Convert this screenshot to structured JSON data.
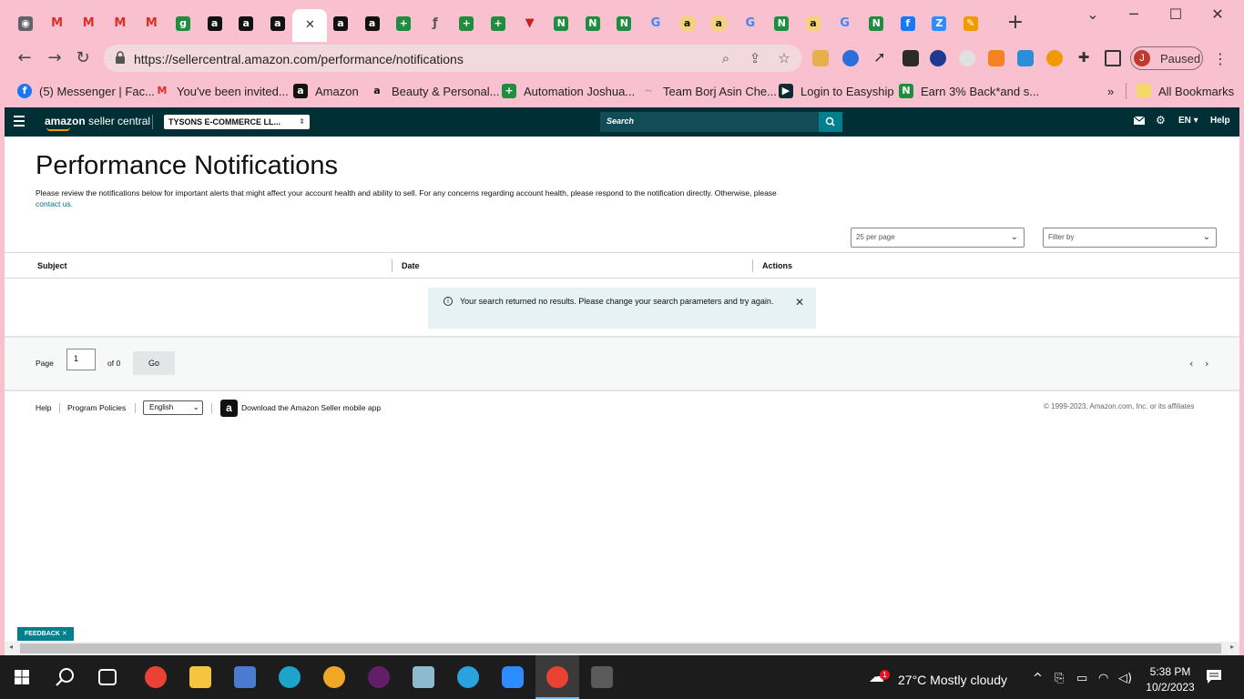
{
  "browser": {
    "url": "https://sellercentral.amazon.com/performance/notifications",
    "profile_initial": "J",
    "profile_status": "Paused",
    "tabs": [
      {
        "icon": "chrome-icon",
        "color": "#5f6368",
        "glyph": "◉"
      },
      {
        "icon": "gmail-icon",
        "color": "#d93025",
        "glyph": "M"
      },
      {
        "icon": "gmail-icon",
        "color": "#d93025",
        "glyph": "M"
      },
      {
        "icon": "gmail-icon",
        "color": "#d93025",
        "glyph": "M"
      },
      {
        "icon": "gmail-icon",
        "color": "#d93025",
        "glyph": "M"
      },
      {
        "icon": "green-circle-icon",
        "color": "#1e8e3e",
        "glyph": "g"
      },
      {
        "icon": "amazon-icon",
        "color": "#111111",
        "glyph": "a"
      },
      {
        "icon": "amazon-icon",
        "color": "#111111",
        "glyph": "a"
      },
      {
        "icon": "amazon-icon",
        "color": "#111111",
        "glyph": "a"
      },
      {
        "icon": "close-icon",
        "color": "#333333",
        "glyph": "✕"
      },
      {
        "icon": "amazon-icon",
        "color": "#111111",
        "glyph": "a"
      },
      {
        "icon": "amazon-icon",
        "color": "#111111",
        "glyph": "a"
      },
      {
        "icon": "sheets-plus-icon",
        "color": "#1e8e3e",
        "glyph": "+"
      },
      {
        "icon": "script-icon",
        "color": "#555555",
        "glyph": "ƒ"
      },
      {
        "icon": "sheets-plus-icon",
        "color": "#1e8e3e",
        "glyph": "+"
      },
      {
        "icon": "sheets-plus-icon",
        "color": "#1e8e3e",
        "glyph": "+"
      },
      {
        "icon": "red-down-icon",
        "color": "#c5221f",
        "glyph": "▼"
      },
      {
        "icon": "green-n-icon",
        "color": "#1e8e3e",
        "glyph": "N"
      },
      {
        "icon": "green-n-icon",
        "color": "#1e8e3e",
        "glyph": "N"
      },
      {
        "icon": "green-n-icon",
        "color": "#1e8e3e",
        "glyph": "N"
      },
      {
        "icon": "google-icon",
        "color": "#4285f4",
        "glyph": "G"
      },
      {
        "icon": "amazon-icon",
        "color": "#ffffff",
        "glyph": "a"
      },
      {
        "icon": "amazon-icon",
        "color": "#ffffff",
        "glyph": "a"
      },
      {
        "icon": "google-icon",
        "color": "#4285f4",
        "glyph": "G"
      },
      {
        "icon": "green-n-icon",
        "color": "#1e8e3e",
        "glyph": "N"
      },
      {
        "icon": "amazon-icon",
        "color": "#ffffff",
        "glyph": "a"
      },
      {
        "icon": "google-icon",
        "color": "#4285f4",
        "glyph": "G"
      },
      {
        "icon": "green-n-icon",
        "color": "#1e8e3e",
        "glyph": "N"
      },
      {
        "icon": "facebook-icon",
        "color": "#1877f2",
        "glyph": "f"
      },
      {
        "icon": "zoom-icon",
        "color": "#2d8cff",
        "glyph": "Z"
      },
      {
        "icon": "pencil-icon",
        "color": "#f29900",
        "glyph": "✎"
      }
    ],
    "bookmarks": [
      {
        "label": "(5) Messenger | Fac...",
        "icon": "facebook-icon",
        "color": "#1877f2",
        "glyph": "f"
      },
      {
        "label": "You've been invited...",
        "icon": "gmail-icon",
        "color": "#d93025",
        "glyph": "M"
      },
      {
        "label": "Amazon",
        "icon": "amazon-icon",
        "color": "#111111",
        "glyph": "a"
      },
      {
        "label": "Beauty & Personal...",
        "icon": "amazon-icon",
        "color": "#f9c1cf",
        "glyph": "a"
      },
      {
        "label": "Automation Joshua...",
        "icon": "sheets-plus-icon",
        "color": "#1e8e3e",
        "glyph": "+"
      },
      {
        "label": "Team Borj Asin Che...",
        "icon": "logo-icon",
        "color": "#9e9e9e",
        "glyph": "~"
      },
      {
        "label": "Login to Easyship",
        "icon": "easyship-icon",
        "color": "#0b2c33",
        "glyph": "▶"
      },
      {
        "label": "Earn 3% Back*and s...",
        "icon": "green-n-icon",
        "color": "#1e8e3e",
        "glyph": "N"
      }
    ],
    "all_bookmarks": "All Bookmarks"
  },
  "seller_header": {
    "logo_bold": "amazon",
    "logo_rest": " seller central",
    "account": "TYSONS E-COMMERCE LL...",
    "search_placeholder": "Search",
    "language": "EN",
    "help": "Help"
  },
  "page": {
    "title": "Performance Notifications",
    "intro": "Please review the notifications below for important alerts that might affect your account health and ability to sell. For any concerns regarding account health, please respond to the notification directly. Otherwise, please",
    "contact_link": "contact us.",
    "per_page": "25 per page",
    "filter_placeholder": "Filter by",
    "columns": {
      "subject": "Subject",
      "date": "Date",
      "actions": "Actions"
    },
    "alert": "Your search returned no results. Please change your search parameters and try again.",
    "pagination": {
      "page_label": "Page",
      "page_value": "1",
      "of_label": "of 0",
      "go": "Go"
    }
  },
  "footer": {
    "help": "Help",
    "program_policies": "Program Policies",
    "language": "English",
    "download_app": "Download the Amazon Seller mobile app",
    "copyright": "© 1999-2023, Amazon.com, Inc. or its affiliates"
  },
  "feedback": "FEEDBACK",
  "taskbar": {
    "weather": "27°C  Mostly cloudy",
    "weather_badge": "1",
    "time": "5:38 PM",
    "date": "10/2/2023"
  }
}
